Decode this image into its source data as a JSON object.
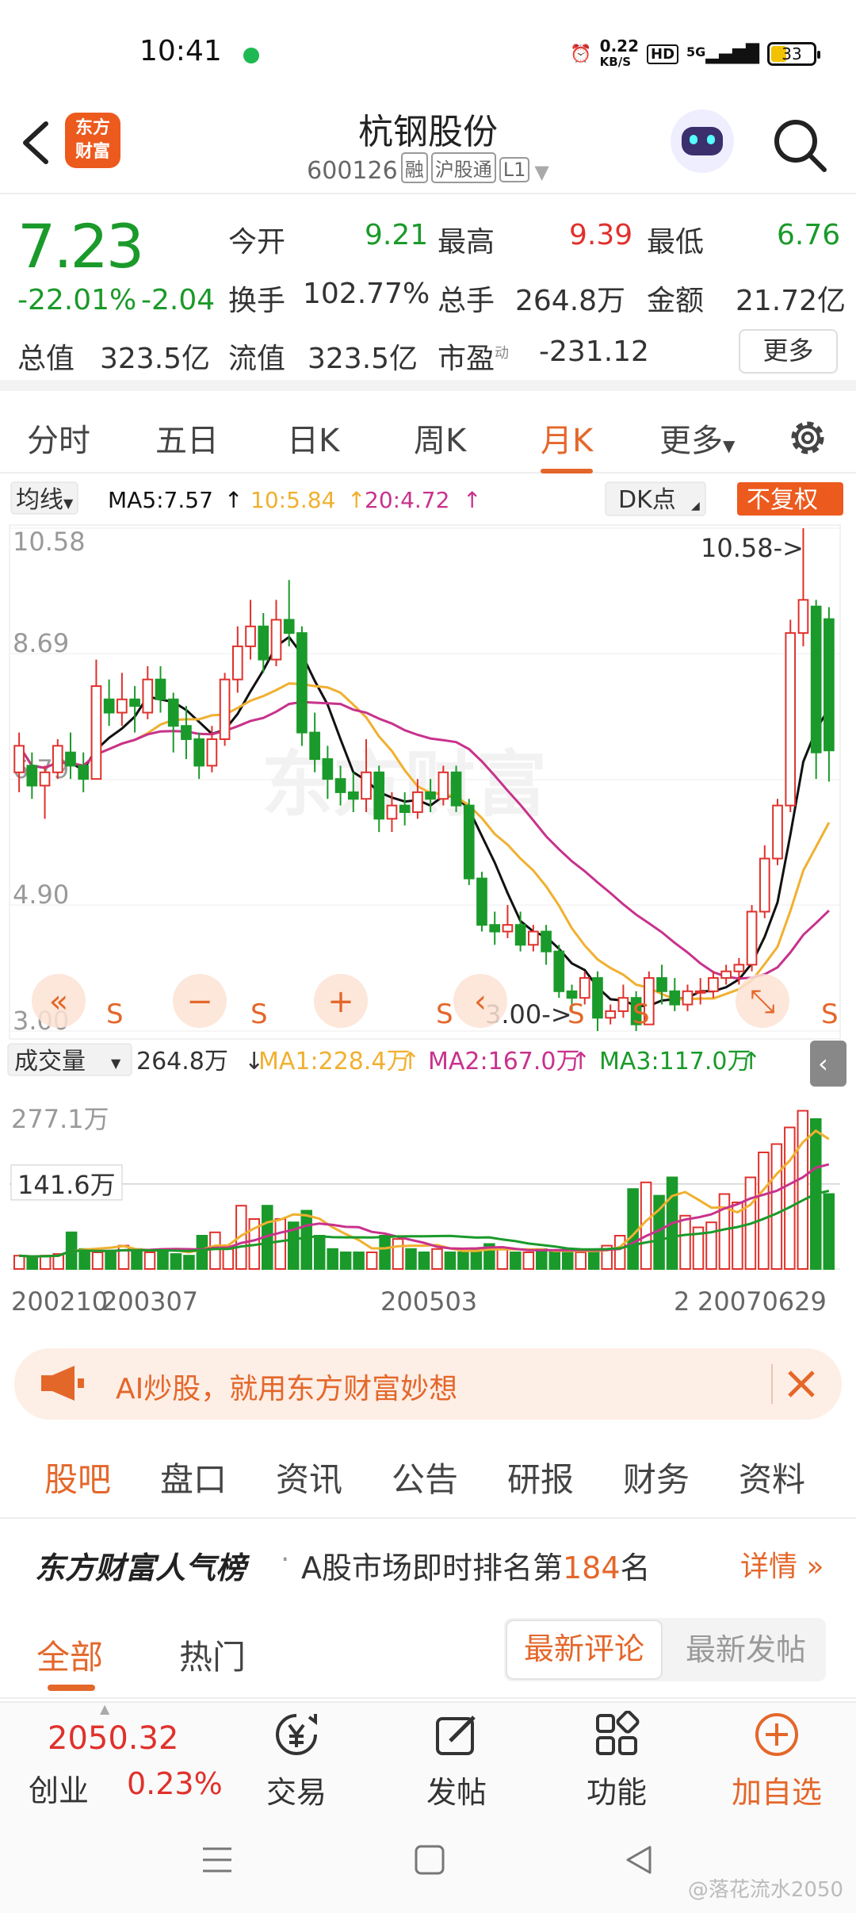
{
  "status_bar": {
    "time": "10:41",
    "net_speed_value": "0.22",
    "net_speed_unit": "KB/S",
    "hd": "HD",
    "signal": "5G",
    "battery": "33"
  },
  "header": {
    "logo_line1": "东方",
    "logo_line2": "财富",
    "stock_name": "杭钢股份",
    "stock_code": "600126",
    "tags": [
      "融",
      "沪股通",
      "L1"
    ]
  },
  "quote": {
    "price": "7.23",
    "change_pct": "-22.01%",
    "change": "-2.04",
    "open_label": "今开",
    "open": "9.21",
    "high_label": "最高",
    "high": "9.39",
    "low_label": "最低",
    "low": "6.76",
    "turnover_label": "换手",
    "turnover": "102.77%",
    "volume_label": "总手",
    "volume": "264.8万",
    "amount_label": "金额",
    "amount": "21.72亿",
    "mktcap_label": "总值",
    "mktcap": "323.5亿",
    "float_label": "流值",
    "float": "323.5亿",
    "pe_label": "市盈",
    "pe_sup": "动",
    "pe": "-231.12",
    "more": "更多"
  },
  "period_tabs": {
    "items": [
      "分时",
      "五日",
      "日K",
      "周K",
      "月K",
      "更多"
    ],
    "active": "月K"
  },
  "chart": {
    "ma_label": "均线",
    "ma5": "MA5:7.57",
    "ma10": "10:5.84",
    "ma20": "20:4.72",
    "dk": "DK点",
    "fuquan": "不复权",
    "y_labels": [
      "10.58",
      "8.69",
      "6.79",
      "4.90",
      "3.00"
    ],
    "max_marker": "10.58->",
    "min_marker": "3.00->",
    "vol_label": "成交量",
    "vol_value": "264.8万",
    "vol_ma1": "MA1:228.4万",
    "vol_ma2": "MA2:167.0万",
    "vol_ma3": "MA3:117.0万",
    "vol_max": "277.1万",
    "vol_ref": "141.6万",
    "x_labels": [
      "200210",
      "200307",
      "200503",
      "2",
      "20070629"
    ],
    "s_marker": "S",
    "colors": {
      "up": "#e0312c",
      "down": "#1a9a2a",
      "ma5": "#111111",
      "ma10": "#f0b030",
      "ma20": "#c8328c"
    }
  },
  "chart_data": {
    "type": "candlestick",
    "period": "monthly",
    "ylim": [
      3.0,
      10.58
    ],
    "candles": [
      {
        "o": 6.9,
        "c": 7.3,
        "h": 7.5,
        "l": 6.6
      },
      {
        "o": 7.0,
        "c": 6.7,
        "h": 7.2,
        "l": 6.5
      },
      {
        "o": 6.7,
        "c": 6.9,
        "h": 7.0,
        "l": 6.2
      },
      {
        "o": 6.9,
        "c": 7.3,
        "h": 7.4,
        "l": 6.8
      },
      {
        "o": 7.2,
        "c": 7.0,
        "h": 7.5,
        "l": 6.8
      },
      {
        "o": 7.0,
        "c": 6.8,
        "h": 7.2,
        "l": 6.6
      },
      {
        "o": 6.8,
        "c": 8.2,
        "h": 8.6,
        "l": 6.8
      },
      {
        "o": 8.0,
        "c": 7.8,
        "h": 8.3,
        "l": 7.6
      },
      {
        "o": 7.8,
        "c": 8.0,
        "h": 8.4,
        "l": 7.6
      },
      {
        "o": 8.0,
        "c": 7.9,
        "h": 8.2,
        "l": 7.5
      },
      {
        "o": 7.8,
        "c": 8.3,
        "h": 8.5,
        "l": 7.7
      },
      {
        "o": 8.3,
        "c": 8.0,
        "h": 8.5,
        "l": 7.8
      },
      {
        "o": 8.0,
        "c": 7.6,
        "h": 8.1,
        "l": 7.2
      },
      {
        "o": 7.6,
        "c": 7.4,
        "h": 7.9,
        "l": 7.1
      },
      {
        "o": 7.4,
        "c": 7.0,
        "h": 7.5,
        "l": 6.8
      },
      {
        "o": 7.0,
        "c": 7.4,
        "h": 7.6,
        "l": 6.9
      },
      {
        "o": 7.4,
        "c": 8.3,
        "h": 8.4,
        "l": 7.3
      },
      {
        "o": 8.3,
        "c": 8.8,
        "h": 9.1,
        "l": 8.1
      },
      {
        "o": 8.8,
        "c": 9.1,
        "h": 9.5,
        "l": 8.6
      },
      {
        "o": 9.1,
        "c": 8.6,
        "h": 9.3,
        "l": 8.4
      },
      {
        "o": 8.6,
        "c": 9.2,
        "h": 9.5,
        "l": 8.5
      },
      {
        "o": 9.2,
        "c": 9.0,
        "h": 9.8,
        "l": 8.8
      },
      {
        "o": 9.0,
        "c": 7.5,
        "h": 9.1,
        "l": 7.3
      },
      {
        "o": 7.5,
        "c": 7.1,
        "h": 7.8,
        "l": 6.9
      },
      {
        "o": 7.1,
        "c": 6.8,
        "h": 7.3,
        "l": 6.5
      },
      {
        "o": 6.8,
        "c": 6.6,
        "h": 7.0,
        "l": 6.4
      },
      {
        "o": 6.6,
        "c": 6.5,
        "h": 6.9,
        "l": 6.3
      },
      {
        "o": 6.5,
        "c": 6.9,
        "h": 7.4,
        "l": 6.3
      },
      {
        "o": 6.9,
        "c": 6.2,
        "h": 7.0,
        "l": 6.0
      },
      {
        "o": 6.2,
        "c": 6.4,
        "h": 6.6,
        "l": 6.0
      },
      {
        "o": 6.4,
        "c": 6.3,
        "h": 6.6,
        "l": 6.1
      },
      {
        "o": 6.3,
        "c": 6.6,
        "h": 6.8,
        "l": 6.2
      },
      {
        "o": 6.6,
        "c": 6.5,
        "h": 6.8,
        "l": 6.3
      },
      {
        "o": 6.5,
        "c": 6.9,
        "h": 7.0,
        "l": 6.4
      },
      {
        "o": 6.9,
        "c": 6.4,
        "h": 7.0,
        "l": 6.3
      },
      {
        "o": 6.4,
        "c": 5.3,
        "h": 6.5,
        "l": 5.2
      },
      {
        "o": 5.3,
        "c": 4.6,
        "h": 5.4,
        "l": 4.5
      },
      {
        "o": 4.6,
        "c": 4.5,
        "h": 4.8,
        "l": 4.3
      },
      {
        "o": 4.5,
        "c": 4.6,
        "h": 4.9,
        "l": 4.4
      },
      {
        "o": 4.6,
        "c": 4.3,
        "h": 4.8,
        "l": 4.2
      },
      {
        "o": 4.3,
        "c": 4.5,
        "h": 4.6,
        "l": 4.2
      },
      {
        "o": 4.5,
        "c": 4.2,
        "h": 4.6,
        "l": 4.0
      },
      {
        "o": 4.2,
        "c": 3.6,
        "h": 4.3,
        "l": 3.5
      },
      {
        "o": 3.6,
        "c": 3.5,
        "h": 3.7,
        "l": 3.3
      },
      {
        "o": 3.5,
        "c": 3.8,
        "h": 3.9,
        "l": 3.4
      },
      {
        "o": 3.8,
        "c": 3.2,
        "h": 3.9,
        "l": 3.0
      },
      {
        "o": 3.2,
        "c": 3.3,
        "h": 3.4,
        "l": 3.1
      },
      {
        "o": 3.3,
        "c": 3.5,
        "h": 3.7,
        "l": 3.2
      },
      {
        "o": 3.5,
        "c": 3.1,
        "h": 3.6,
        "l": 3.0
      },
      {
        "o": 3.1,
        "c": 3.8,
        "h": 3.9,
        "l": 3.1
      },
      {
        "o": 3.8,
        "c": 3.6,
        "h": 4.0,
        "l": 3.4
      },
      {
        "o": 3.6,
        "c": 3.4,
        "h": 3.8,
        "l": 3.3
      },
      {
        "o": 3.4,
        "c": 3.6,
        "h": 3.7,
        "l": 3.3
      },
      {
        "o": 3.6,
        "c": 3.6,
        "h": 3.8,
        "l": 3.4
      },
      {
        "o": 3.6,
        "c": 3.8,
        "h": 3.9,
        "l": 3.5
      },
      {
        "o": 3.8,
        "c": 3.9,
        "h": 4.0,
        "l": 3.7
      },
      {
        "o": 3.9,
        "c": 4.0,
        "h": 4.1,
        "l": 3.7
      },
      {
        "o": 4.0,
        "c": 4.8,
        "h": 4.9,
        "l": 3.9
      },
      {
        "o": 4.8,
        "c": 5.6,
        "h": 5.8,
        "l": 4.7
      },
      {
        "o": 5.6,
        "c": 6.4,
        "h": 6.5,
        "l": 5.5
      },
      {
        "o": 6.4,
        "c": 9.0,
        "h": 9.2,
        "l": 6.3
      },
      {
        "o": 9.0,
        "c": 9.5,
        "h": 10.58,
        "l": 8.8
      },
      {
        "o": 9.4,
        "c": 7.2,
        "h": 9.5,
        "l": 6.8
      },
      {
        "o": 9.21,
        "c": 7.23,
        "h": 9.39,
        "l": 6.76
      }
    ],
    "volume": [
      0.08,
      0.07,
      0.08,
      0.09,
      0.22,
      0.12,
      0.1,
      0.11,
      0.14,
      0.12,
      0.1,
      0.11,
      0.09,
      0.08,
      0.2,
      0.22,
      0.12,
      0.38,
      0.3,
      0.38,
      0.3,
      0.28,
      0.35,
      0.2,
      0.12,
      0.1,
      0.1,
      0.1,
      0.2,
      0.18,
      0.12,
      0.1,
      0.12,
      0.1,
      0.1,
      0.12,
      0.15,
      0.12,
      0.1,
      0.1,
      0.12,
      0.1,
      0.12,
      0.1,
      0.1,
      0.14,
      0.2,
      0.48,
      0.52,
      0.44,
      0.55,
      0.32,
      0.25,
      0.28,
      0.45,
      0.4,
      0.55,
      0.7,
      0.75,
      0.85,
      0.95,
      0.9,
      0.45
    ]
  },
  "ad": {
    "text": "AI炒股，就用东方财富妙想"
  },
  "sub_tabs": {
    "items": [
      "股吧",
      "盘口",
      "资讯",
      "公告",
      "研报",
      "财务",
      "资料"
    ],
    "active": "股吧"
  },
  "rank": {
    "title": "东方财富人气榜",
    "dot": "·",
    "prefix": "A股市场即时排名第",
    "number": "184",
    "suffix": "名",
    "detail": "详情"
  },
  "filter": {
    "all": "全部",
    "hot": "热门",
    "latest_comment": "最新评论",
    "latest_post": "最新发帖"
  },
  "bottom_bar": {
    "index_value": "2050.32",
    "index_name": "创业",
    "index_pct": "0.23%",
    "trade": "交易",
    "post": "发帖",
    "func": "功能",
    "add": "加自选"
  },
  "watermark": "@落花流水2050"
}
